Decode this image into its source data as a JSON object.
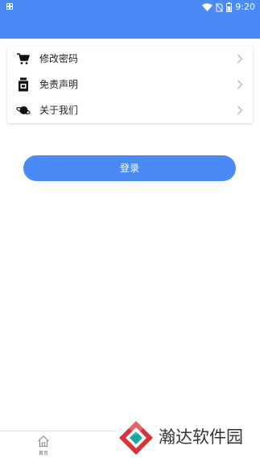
{
  "status_bar": {
    "time": "9:20",
    "background_color": "#4a8af4",
    "icons": [
      "notification-icon",
      "wifi-icon",
      "no-sim-icon",
      "battery-icon"
    ]
  },
  "menu": {
    "items": [
      {
        "label": "修改密码",
        "icon": "cart-icon"
      },
      {
        "label": "免责声明",
        "icon": "bottle-icon"
      },
      {
        "label": "关于我们",
        "icon": "planet-icon"
      }
    ]
  },
  "login_button": {
    "label": "登录",
    "color": "#4a8af4"
  },
  "bottom_nav": {
    "items": [
      {
        "label": "首页",
        "icon": "home-icon"
      }
    ]
  },
  "watermark": {
    "text": "瀚达软件园"
  }
}
